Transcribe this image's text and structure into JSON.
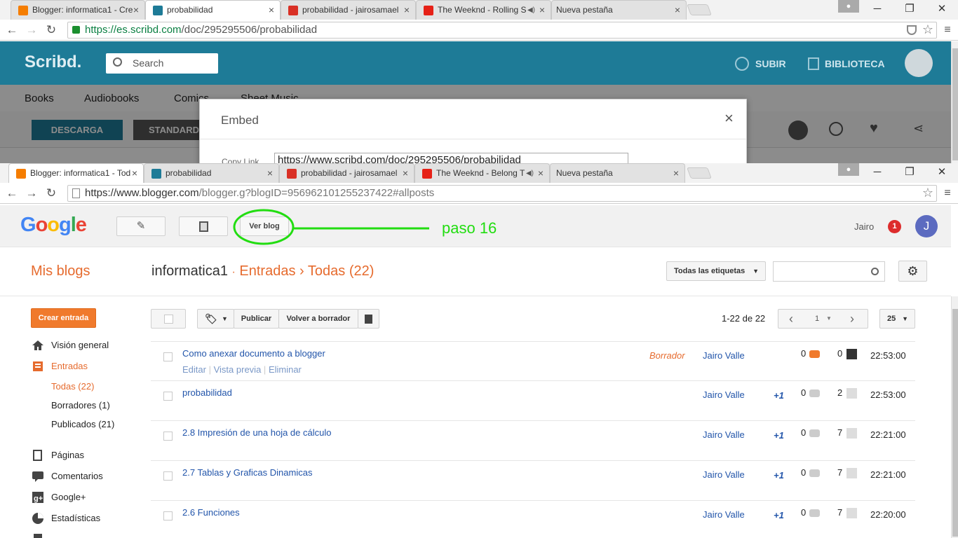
{
  "top_window": {
    "tabs": [
      {
        "title": "Blogger: informatica1 - Cre",
        "favicon_color": "#f57d00"
      },
      {
        "title": "probabilidad",
        "favicon_color": "#1e7b97"
      },
      {
        "title": "probabilidad - jairosamael",
        "favicon_color": "#d93025"
      },
      {
        "title": "The Weeknd - Rolling S",
        "favicon_color": "#e62117"
      },
      {
        "title": "Nueva pestaña",
        "favicon_color": ""
      }
    ],
    "url_host": "https://es.scribd.com",
    "url_path": "/doc/295295506/probabilidad",
    "scribd": {
      "logo": "Scribd.",
      "search_label": "Search",
      "upload": "SUBIR",
      "library": "BIBLIOTECA",
      "nav": [
        "Books",
        "Audiobooks",
        "Comics",
        "Sheet Music"
      ],
      "download": "DESCARGA",
      "standard": "STANDARD"
    },
    "embed_modal": {
      "title": "Embed",
      "copy_link_label": "Copy Link",
      "copy_link_value": "https://www.scribd.com/doc/295295506/probabilidad"
    }
  },
  "bottom_window": {
    "tabs": [
      {
        "title": "Blogger: informatica1 - Tod",
        "favicon_color": "#f57d00"
      },
      {
        "title": "probabilidad",
        "favicon_color": "#1e7b97"
      },
      {
        "title": "probabilidad - jairosamael",
        "favicon_color": "#d93025"
      },
      {
        "title": "The Weeknd - Belong T",
        "favicon_color": "#e62117"
      },
      {
        "title": "Nueva pestaña",
        "favicon_color": ""
      }
    ],
    "url_host": "https://www.blogger.com",
    "url_path": "/blogger.g?blogID=956962101255237422#allposts"
  },
  "blogger": {
    "ver_blog": "Ver blog",
    "annotation": "paso 16",
    "user_name": "Jairo",
    "notif_count": "1",
    "avatar_letter": "J",
    "my_blogs": "Mis blogs",
    "blog_name": "informatica1",
    "crumb_sep": "·",
    "crumb_section": "Entradas",
    "crumb_arrow": "›",
    "crumb_current": "Todas (22)",
    "labels_dropdown": "Todas las etiquetas",
    "create_post": "Crear entrada",
    "publish": "Publicar",
    "revert_draft": "Volver a borrador",
    "pager_text": "1-22 de 22",
    "page_num": "1",
    "per_page": "25",
    "sidebar": [
      {
        "label": "Visión general",
        "icon": "home-icon"
      },
      {
        "label": "Entradas",
        "icon": "posts-icon"
      },
      {
        "label": "Páginas",
        "icon": "pages-icon"
      },
      {
        "label": "Comentarios",
        "icon": "comments-icon"
      },
      {
        "label": "Google+",
        "icon": "google-plus-icon"
      },
      {
        "label": "Estadísticas",
        "icon": "stats-icon"
      }
    ],
    "sidebar_sub": [
      "Todas (22)",
      "Borradores (1)",
      "Publicados (21)"
    ],
    "row_actions": [
      "Editar",
      "Vista previa",
      "Eliminar"
    ],
    "action_sep": "|",
    "posts": [
      {
        "title": "Como anexar documento a blogger",
        "status": "Borrador",
        "author": "Jairo Valle",
        "plus": "",
        "comments": "0",
        "views": "0",
        "time": "22:53:00"
      },
      {
        "title": "probabilidad",
        "status": "",
        "author": "Jairo Valle",
        "plus": "+1",
        "comments": "0",
        "views": "2",
        "time": "22:53:00"
      },
      {
        "title": "2.8 Impresión de una hoja de cálculo",
        "status": "",
        "author": "Jairo Valle",
        "plus": "+1",
        "comments": "0",
        "views": "7",
        "time": "22:21:00"
      },
      {
        "title": "2.7 Tablas y Graficas Dinamicas",
        "status": "",
        "author": "Jairo Valle",
        "plus": "+1",
        "comments": "0",
        "views": "7",
        "time": "22:21:00"
      },
      {
        "title": "2.6 Funciones",
        "status": "",
        "author": "Jairo Valle",
        "plus": "+1",
        "comments": "0",
        "views": "7",
        "time": "22:20:00"
      }
    ]
  },
  "colors": {
    "blogger_orange": "#e66b2e",
    "link_blue": "#2255aa",
    "annotation_green": "#22dd11",
    "scribd_blue": "#1e7b97"
  }
}
